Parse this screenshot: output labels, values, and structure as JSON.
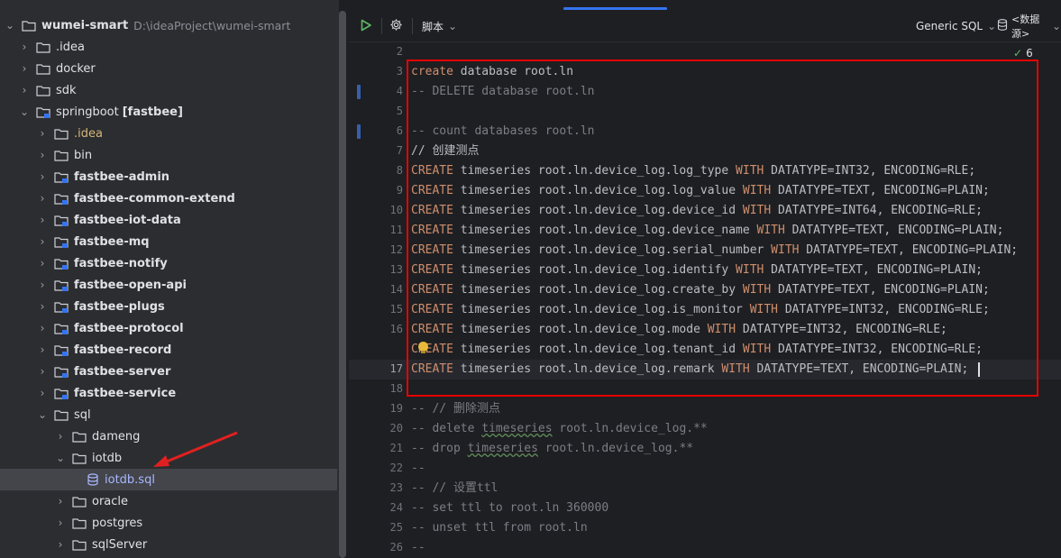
{
  "tree": {
    "root": {
      "name": "wumei-smart",
      "path": "D:\\ideaProject\\wumei-smart"
    },
    "items": [
      {
        "label": ".idea"
      },
      {
        "label": "docker"
      },
      {
        "label": "sdk"
      },
      {
        "label": "springboot",
        "module": "[fastbee]"
      },
      {
        "label": ".idea"
      },
      {
        "label": "bin"
      },
      {
        "label": "fastbee-admin"
      },
      {
        "label": "fastbee-common-extend"
      },
      {
        "label": "fastbee-iot-data"
      },
      {
        "label": "fastbee-mq"
      },
      {
        "label": "fastbee-notify"
      },
      {
        "label": "fastbee-open-api"
      },
      {
        "label": "fastbee-plugs"
      },
      {
        "label": "fastbee-protocol"
      },
      {
        "label": "fastbee-record"
      },
      {
        "label": "fastbee-server"
      },
      {
        "label": "fastbee-service"
      },
      {
        "label": "sql"
      },
      {
        "label": "dameng"
      },
      {
        "label": "iotdb"
      },
      {
        "label": "iotdb.sql"
      },
      {
        "label": "oracle"
      },
      {
        "label": "postgres"
      },
      {
        "label": "sqlServer"
      }
    ]
  },
  "toolbar": {
    "run_icon": "play-icon",
    "settings_icon": "gear-icon",
    "script_label": "脚本",
    "dialect_label": "Generic SQL",
    "datasource_label": "<数据源>"
  },
  "inspections": {
    "count": "6"
  },
  "editor": {
    "line_numbers": [
      "2",
      "3",
      "4",
      "5",
      "6",
      "7",
      "8",
      "9",
      "10",
      "11",
      "12",
      "13",
      "14",
      "15",
      "16",
      "17",
      "18",
      "19",
      "20",
      "21",
      "22",
      "23",
      "24",
      "25",
      "26"
    ],
    "lines": {
      "l2": {
        "a": "create",
        "b": " database root.ln"
      },
      "l3": {
        "a": "-- DELETE database root.ln"
      },
      "l4": {
        "a": ""
      },
      "l5": {
        "a": "-- count databases root.ln"
      },
      "l6": {
        "a": "// 创建测点"
      },
      "l7": {
        "a": "CREATE",
        "b": " timeseries root.ln.device_log.log_type ",
        "c": "WITH",
        "d": " DATATYPE=INT32, ENCODING=RLE;"
      },
      "l8": {
        "a": "CREATE",
        "b": " timeseries root.ln.device_log.log_value ",
        "c": "WITH",
        "d": " DATATYPE=TEXT, ENCODING=PLAIN;"
      },
      "l9": {
        "a": "CREATE",
        "b": " timeseries root.ln.device_log.device_id ",
        "c": "WITH",
        "d": " DATATYPE=INT64, ENCODING=RLE;"
      },
      "l10": {
        "a": "CREATE",
        "b": " timeseries root.ln.device_log.device_name ",
        "c": "WITH",
        "d": " DATATYPE=TEXT, ENCODING=PLAIN;"
      },
      "l11": {
        "a": "CREATE",
        "b": " timeseries root.ln.device_log.serial_number ",
        "c": "WITH",
        "d": " DATATYPE=TEXT, ENCODING=PLAIN;"
      },
      "l12": {
        "a": "CREATE",
        "b": " timeseries root.ln.device_log.identify ",
        "c": "WITH",
        "d": " DATATYPE=TEXT, ENCODING=PLAIN;"
      },
      "l13": {
        "a": "CREATE",
        "b": " timeseries root.ln.device_log.create_by ",
        "c": "WITH",
        "d": " DATATYPE=TEXT, ENCODING=PLAIN;"
      },
      "l14": {
        "a": "CREATE",
        "b": " timeseries root.ln.device_log.is_monitor ",
        "c": "WITH",
        "d": " DATATYPE=INT32, ENCODING=RLE;"
      },
      "l15": {
        "a": "CREATE",
        "b": " timeseries root.ln.device_log.mode ",
        "c": "WITH",
        "d": " DATATYPE=INT32, ENCODING=RLE;"
      },
      "l16": {
        "a": "CREATE",
        "b": " timeseries root.ln.device_log.tenant_id ",
        "c": "WITH",
        "d": " DATATYPE=INT32, ENCODING=RLE;"
      },
      "l17": {
        "a": "CREATE",
        "b": " timeseries root.ln.device_log.remark ",
        "c": "WITH",
        "d": " DATATYPE=TEXT, ENCODING=PLAIN;"
      },
      "l18": {
        "a": ""
      },
      "l19": {
        "a": "-- // 删除测点"
      },
      "l20": {
        "a": "-- delete ",
        "b": "timeseries",
        "c": " root.ln.device_log.**"
      },
      "l21": {
        "a": "-- drop ",
        "b": "timeseries",
        "c": " root.ln.device_log.**"
      },
      "l22": {
        "a": "--"
      },
      "l23": {
        "a": "-- // 设置ttl"
      },
      "l24": {
        "a": "-- set ttl to root.ln 360000"
      },
      "l25": {
        "a": "-- unset ttl from root.ln"
      },
      "l26": {
        "a": "--"
      }
    }
  },
  "colors": {
    "keyword": "#cf8e6d",
    "comment": "#7a7e85",
    "highlight_box": "#e60000",
    "arrow": "#e02020"
  }
}
